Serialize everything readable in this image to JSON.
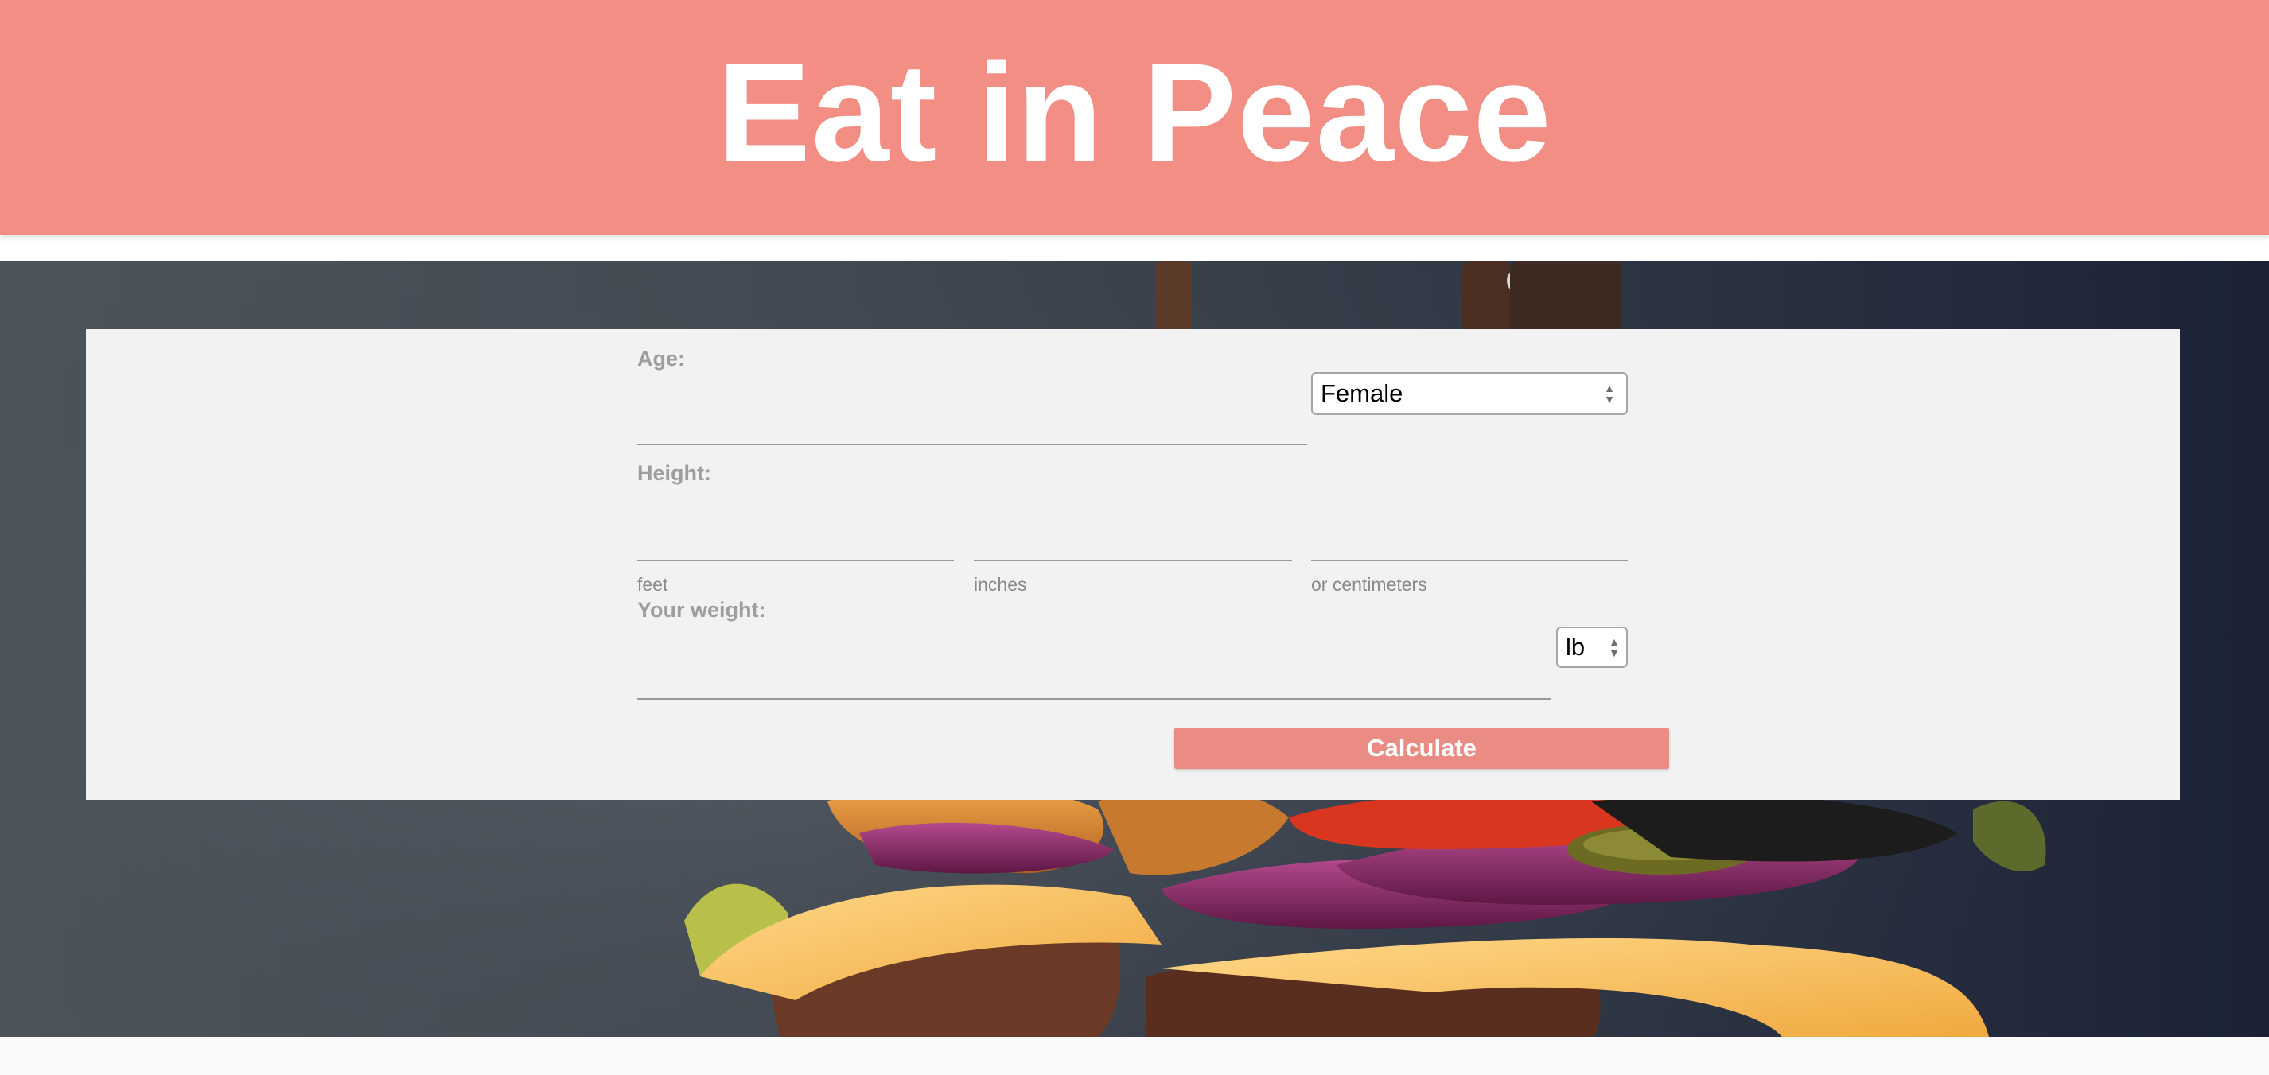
{
  "header": {
    "title": "Eat in Peace"
  },
  "form": {
    "age": {
      "label": "Age:",
      "value": ""
    },
    "sex_select": {
      "selected": "Female"
    },
    "height": {
      "label": "Height:",
      "feet_value": "",
      "feet_caption": "feet",
      "inches_value": "",
      "inches_caption": "inches",
      "cm_value": "",
      "cm_caption": "or centimeters"
    },
    "weight": {
      "label": "Your weight:",
      "value": "",
      "unit_selected": "lb"
    },
    "calculate_label": "Calculate"
  },
  "icons": {
    "select_arrows": "up-down-chevron-icon"
  },
  "colors": {
    "header_bg": "#f28e84",
    "button_bg": "#ea8c84",
    "panel_bg": "#f2f2f2",
    "label_text": "#9e9e9e"
  }
}
